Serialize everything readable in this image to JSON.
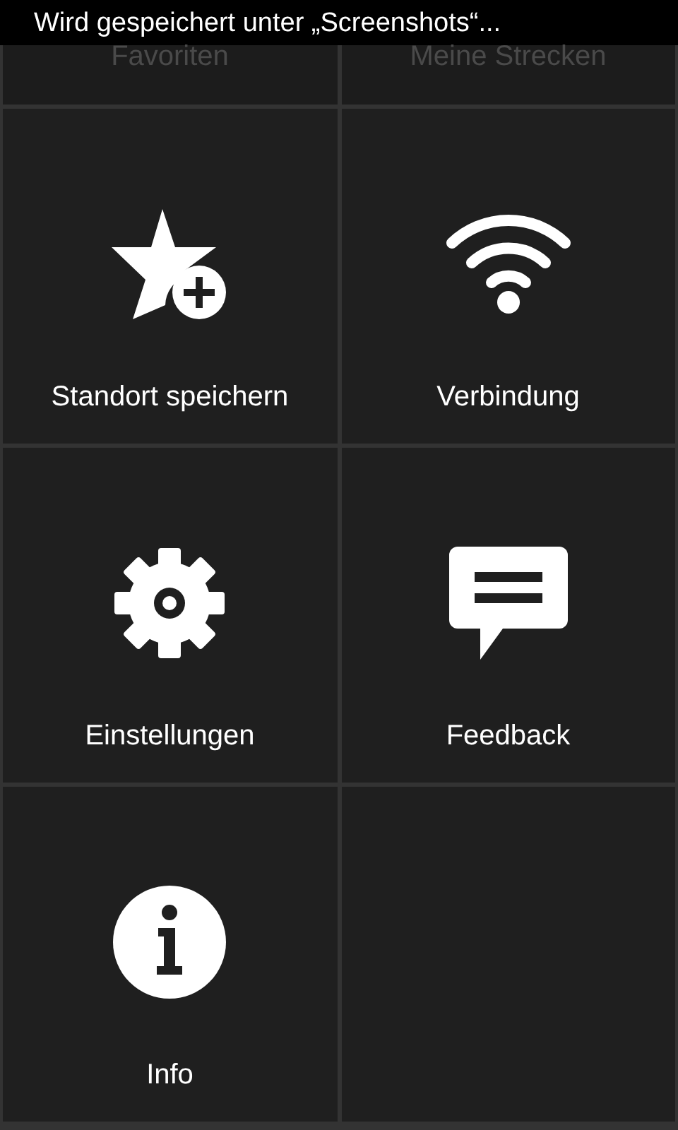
{
  "status_bar": {
    "text": "Wird gespeichert unter „Screenshots“..."
  },
  "tiles": [
    {
      "kind": "partial",
      "label": "Favoriten",
      "disabled": true
    },
    {
      "kind": "partial",
      "label": "Meine Strecken",
      "disabled": true
    },
    {
      "kind": "full",
      "label": "Standort speichern",
      "disabled": false
    },
    {
      "kind": "full",
      "label": "Verbindung",
      "disabled": false
    },
    {
      "kind": "full",
      "label": "Einstellungen",
      "disabled": false
    },
    {
      "kind": "full",
      "label": "Feedback",
      "disabled": false
    },
    {
      "kind": "full",
      "label": "Info",
      "disabled": false
    }
  ]
}
